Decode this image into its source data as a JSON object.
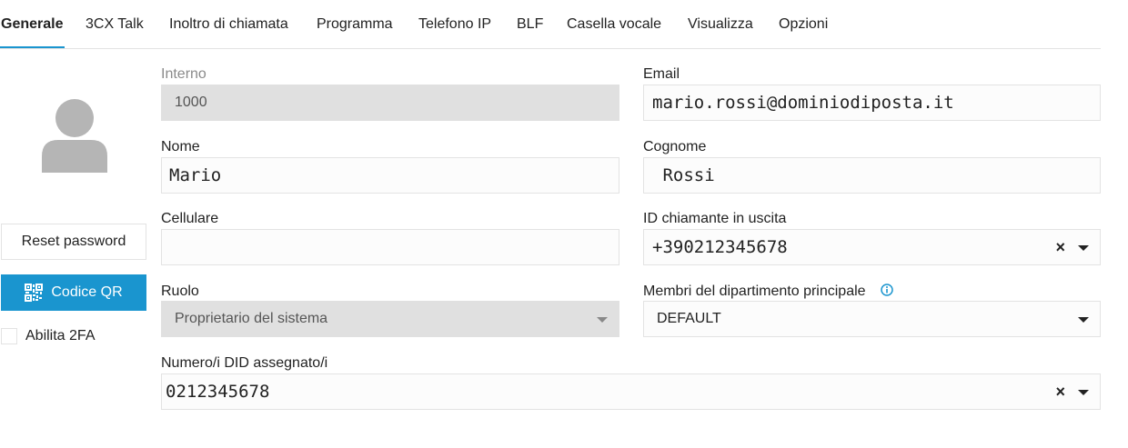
{
  "tabs": [
    "Generale",
    "3CX Talk",
    "Inoltro di chiamata",
    "Programma",
    "Telefono IP",
    "BLF",
    "Casella vocale",
    "Visualizza",
    "Opzioni"
  ],
  "left": {
    "reset_label": "Reset password",
    "qr_label": "Codice QR",
    "twofa_label": "Abilita 2FA",
    "twofa_checked": false
  },
  "form": {
    "interno": {
      "label": "Interno",
      "value": "1000"
    },
    "email": {
      "label": "Email",
      "value": "mario.rossi@dominiodiposta.it"
    },
    "nome": {
      "label": "Nome",
      "value": "Mario"
    },
    "cognome": {
      "label": "Cognome",
      "value": " Rossi"
    },
    "cellulare": {
      "label": "Cellulare",
      "value": ""
    },
    "id_chiamante": {
      "label": "ID chiamante in uscita",
      "value": "+390212345678"
    },
    "ruolo": {
      "label": "Ruolo",
      "value": "Proprietario del sistema"
    },
    "membri": {
      "label": "Membri del dipartimento principale",
      "value": "DEFAULT"
    },
    "did": {
      "label": "Numero/i DID assegnato/i",
      "value": "0212345678"
    }
  },
  "colors": {
    "accent": "#1a95cf",
    "disabled_bg": "#e0e0e0",
    "border": "#e3e3e3",
    "avatar": "#b5b5b5"
  },
  "icons": {
    "clear": "×",
    "dropdown": "caret-down-icon",
    "info": "info-icon",
    "qr": "qr-code-icon",
    "avatar": "user-avatar-icon"
  }
}
